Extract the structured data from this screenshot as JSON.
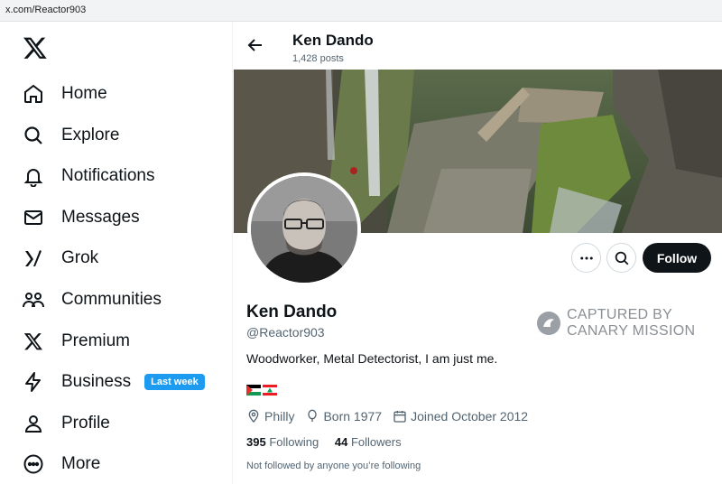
{
  "browser": {
    "url": "x.com/Reactor903"
  },
  "sidebar": {
    "items": [
      {
        "label": "Home",
        "icon": "home-icon"
      },
      {
        "label": "Explore",
        "icon": "search-icon"
      },
      {
        "label": "Notifications",
        "icon": "bell-icon"
      },
      {
        "label": "Messages",
        "icon": "envelope-icon"
      },
      {
        "label": "Grok",
        "icon": "grok-icon"
      },
      {
        "label": "Communities",
        "icon": "people-icon"
      },
      {
        "label": "Premium",
        "icon": "x-logo-icon"
      },
      {
        "label": "Business",
        "icon": "lightning-icon",
        "badge": "Last week"
      },
      {
        "label": "Profile",
        "icon": "person-icon"
      },
      {
        "label": "More",
        "icon": "more-circle-icon"
      }
    ]
  },
  "header": {
    "name": "Ken Dando",
    "posts": "1,428 posts"
  },
  "profile": {
    "name": "Ken Dando",
    "handle": "@Reactor903",
    "bio": "Woodworker, Metal Detectorist, I am just me.",
    "flags": [
      "palestine-flag",
      "lebanon-flag"
    ],
    "location": "Philly",
    "born": "Born 1977",
    "joined": "Joined October 2012",
    "following_count": "395",
    "following_label": "Following",
    "followers_count": "44",
    "followers_label": "Followers",
    "not_followed": "Not followed by anyone you’re following",
    "follow_button": "Follow"
  },
  "watermark": {
    "line1": "CAPTURED BY",
    "line2": "CANARY MISSION"
  },
  "colors": {
    "accent": "#1d9bf0",
    "text": "#0f1419",
    "secondary": "#536471",
    "follow_bg": "#0f1419"
  }
}
